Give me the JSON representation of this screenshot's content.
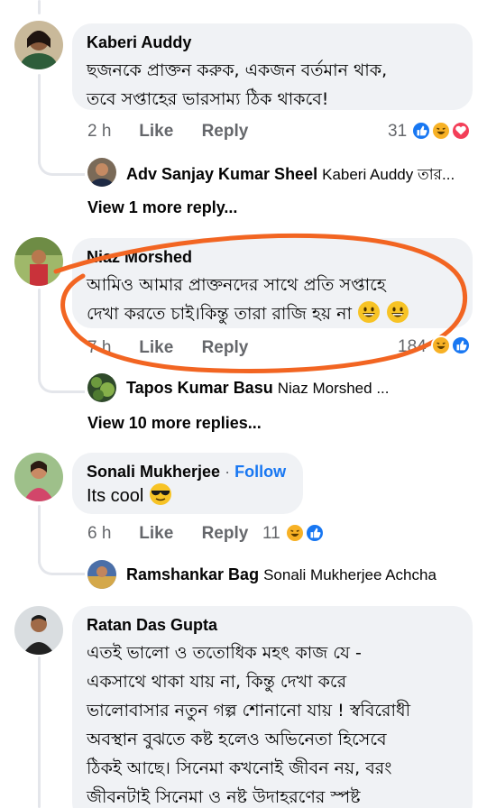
{
  "comments": [
    {
      "author": "Kaberi Auddy",
      "lines": [
        "ছজনকে প্রাক্তন করুক, একজন বর্তমান থাক,",
        "তবে সপ্তাহের ভারসাম্য ঠিক থাকবে!"
      ],
      "time": "2 h",
      "like": "Like",
      "reply": "Reply",
      "reactions": "31",
      "reply_preview": {
        "author": "Adv Sanjay Kumar Sheel",
        "text": "Kaberi Auddy তার..."
      },
      "view_more": "View 1 more reply..."
    },
    {
      "author": "Niaz Morshed",
      "lines": [
        "আমিও আমার  প্রাক্তনদের সাথে প্রতি সপ্তাহে",
        "দেখা করতে চাই।কিন্তু তারা রাজি হয় না"
      ],
      "time": "7 h",
      "like": "Like",
      "reply": "Reply",
      "reactions": "184",
      "reply_preview": {
        "author": "Tapos Kumar Basu",
        "text": "Niaz Morshed ..."
      },
      "view_more": "View 10 more replies..."
    },
    {
      "author": "Sonali Mukherjee",
      "follow": "Follow",
      "lines": [
        "Its cool"
      ],
      "time": "6 h",
      "like": "Like",
      "reply": "Reply",
      "reactions": "11",
      "reply_preview": {
        "author": "Ramshankar Bag",
        "text": "Sonali Mukherjee Achcha"
      }
    },
    {
      "author": "Ratan Das Gupta",
      "lines": [
        "এতই ভালো ও ততোধিক মহৎ কাজ যে -",
        "একসাথে থাকা যায় না, কিন্তু দেখা করে",
        "ভালোবাসার নতুন গল্প শোনানো যায় ! স্ববিরোধী",
        "অবস্থান বুঝতে কষ্ট হলেও অভিনেতা হিসেবে",
        "ঠিকই আছে। সিনেমা কখনোই জীবন নয়, বরং",
        "জীবনটাই সিনেমা ও নষ্ট উদাহরণের স্পষ্ট"
      ]
    }
  ],
  "colors": {
    "like_blue": "#1877f2",
    "haha_yellow": "#f7b125",
    "love_red": "#f33e58",
    "annotation_orange": "#f26522"
  }
}
